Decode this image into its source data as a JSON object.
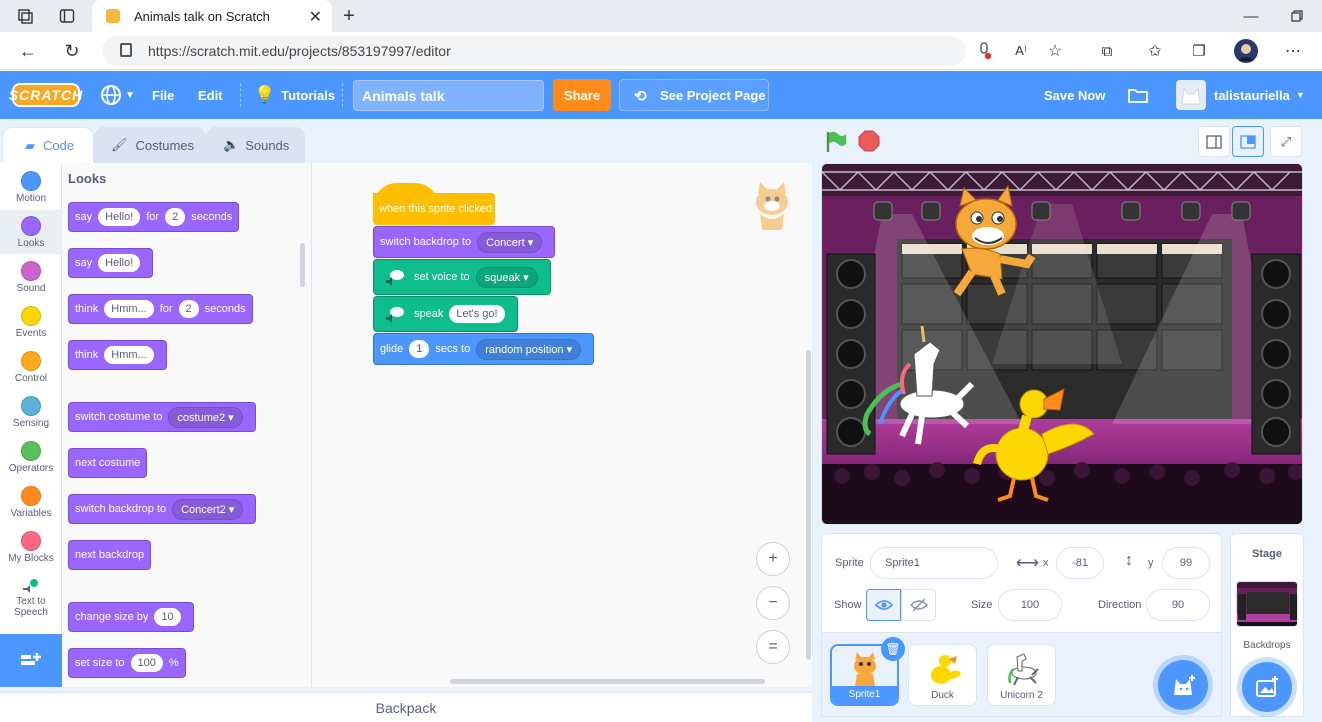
{
  "browser": {
    "tab_title": "Animals talk on Scratch",
    "url": "https://scratch.mit.edu/projects/853197997/editor"
  },
  "menubar": {
    "logo": "SCRATCH",
    "file": "File",
    "edit": "Edit",
    "tutorials": "Tutorials",
    "project_title": "Animals talk",
    "share": "Share",
    "see_project_page": "See Project Page",
    "save_now": "Save Now",
    "username": "talistauriella"
  },
  "editor_tabs": {
    "code": "Code",
    "costumes": "Costumes",
    "sounds": "Sounds"
  },
  "categories": [
    {
      "label": "Motion",
      "color": "#4c97ff"
    },
    {
      "label": "Looks",
      "color": "#9966ff"
    },
    {
      "label": "Sound",
      "color": "#cf63cf"
    },
    {
      "label": "Events",
      "color": "#ffd500"
    },
    {
      "label": "Control",
      "color": "#ffab19"
    },
    {
      "label": "Sensing",
      "color": "#5cb1d6"
    },
    {
      "label": "Operators",
      "color": "#59c059"
    },
    {
      "label": "Variables",
      "color": "#ff8c1a"
    },
    {
      "label": "My Blocks",
      "color": "#ff6680"
    },
    {
      "label": "Text to Speech",
      "color": "#0fbd8c"
    }
  ],
  "palette": {
    "heading": "Looks",
    "say_for": {
      "say": "say",
      "msg": "Hello!",
      "for": "for",
      "secs": "2",
      "seconds": "seconds"
    },
    "say": {
      "say": "say",
      "msg": "Hello!"
    },
    "think_for": {
      "think": "think",
      "msg": "Hmm...",
      "for": "for",
      "secs": "2",
      "seconds": "seconds"
    },
    "think": {
      "think": "think",
      "msg": "Hmm..."
    },
    "switch_costume": {
      "label": "switch costume to",
      "value": "costume2"
    },
    "next_costume": "next costume",
    "switch_backdrop": {
      "label": "switch backdrop to",
      "value": "Concert2"
    },
    "next_backdrop": "next backdrop",
    "change_size": {
      "label": "change size by",
      "value": "10"
    },
    "set_size": {
      "label": "set size to",
      "value": "100",
      "unit": "%"
    }
  },
  "script": {
    "hat": "when this sprite clicked",
    "switch_backdrop": {
      "label": "switch backdrop to",
      "value": "Concert"
    },
    "set_voice": {
      "label": "set voice to",
      "value": "squeak"
    },
    "speak": {
      "label": "speak",
      "value": "Let's go!"
    },
    "glide": {
      "glide": "glide",
      "secs": "1",
      "secs_to": "secs to",
      "target": "random position"
    }
  },
  "zoom": {
    "in": "+",
    "out": "−",
    "reset": "="
  },
  "backpack": "Backpack",
  "sprite_info": {
    "sprite_label": "Sprite",
    "sprite_name": "Sprite1",
    "x_label": "x",
    "x": "-81",
    "y_label": "y",
    "y": "99",
    "show_label": "Show",
    "size_label": "Size",
    "size": "100",
    "direction_label": "Direction",
    "direction": "90"
  },
  "sprites": [
    {
      "name": "Sprite1",
      "selected": true
    },
    {
      "name": "Duck",
      "selected": false
    },
    {
      "name": "Unicorn 2",
      "selected": false
    }
  ],
  "stage_panel": {
    "title": "Stage",
    "backdrops_label": "Backdrops"
  }
}
